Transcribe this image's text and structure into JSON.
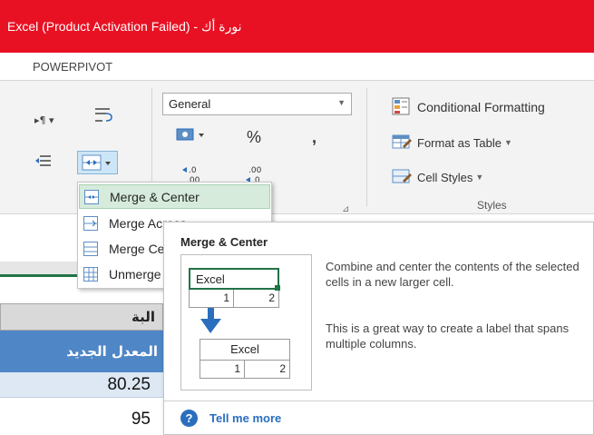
{
  "window": {
    "title": "Excel (Product Activation Failed) - نورة أك"
  },
  "ribbon": {
    "tab_label": "POWERPIVOT",
    "number": {
      "format_value": "General",
      "percent_symbol": "%",
      "comma_symbol": ",",
      "increase_decimal": ".0→.00",
      "decrease_decimal": ".00→.0"
    },
    "styles": {
      "conditional_formatting": "Conditional Formatting",
      "format_as_table": "Format as Table",
      "cell_styles": "Cell Styles",
      "group_label": "Styles"
    }
  },
  "merge_menu": {
    "items": [
      "Merge & Center",
      "Merge Across",
      "Merge Cells",
      "Unmerge Cells"
    ],
    "hovered_index": 0
  },
  "tooltip": {
    "title": "Merge & Center",
    "description": "Combine and center the contents of the selected cells in a new larger cell.",
    "description2": "This is a great way to create a label that spans multiple columns.",
    "link": "Tell me more",
    "illustration": {
      "before_text": "Excel",
      "before_cells": [
        "1",
        "2"
      ],
      "after_text": "Excel",
      "after_cells": [
        "1",
        "2"
      ]
    }
  },
  "sheet": {
    "partial_header": "البة",
    "column_header": "المعدل الجديد",
    "values": [
      "80.25",
      "95"
    ]
  },
  "colors": {
    "titlebar": "#e81123",
    "accent_green": "#217346",
    "header_blue": "#4f86c6"
  }
}
